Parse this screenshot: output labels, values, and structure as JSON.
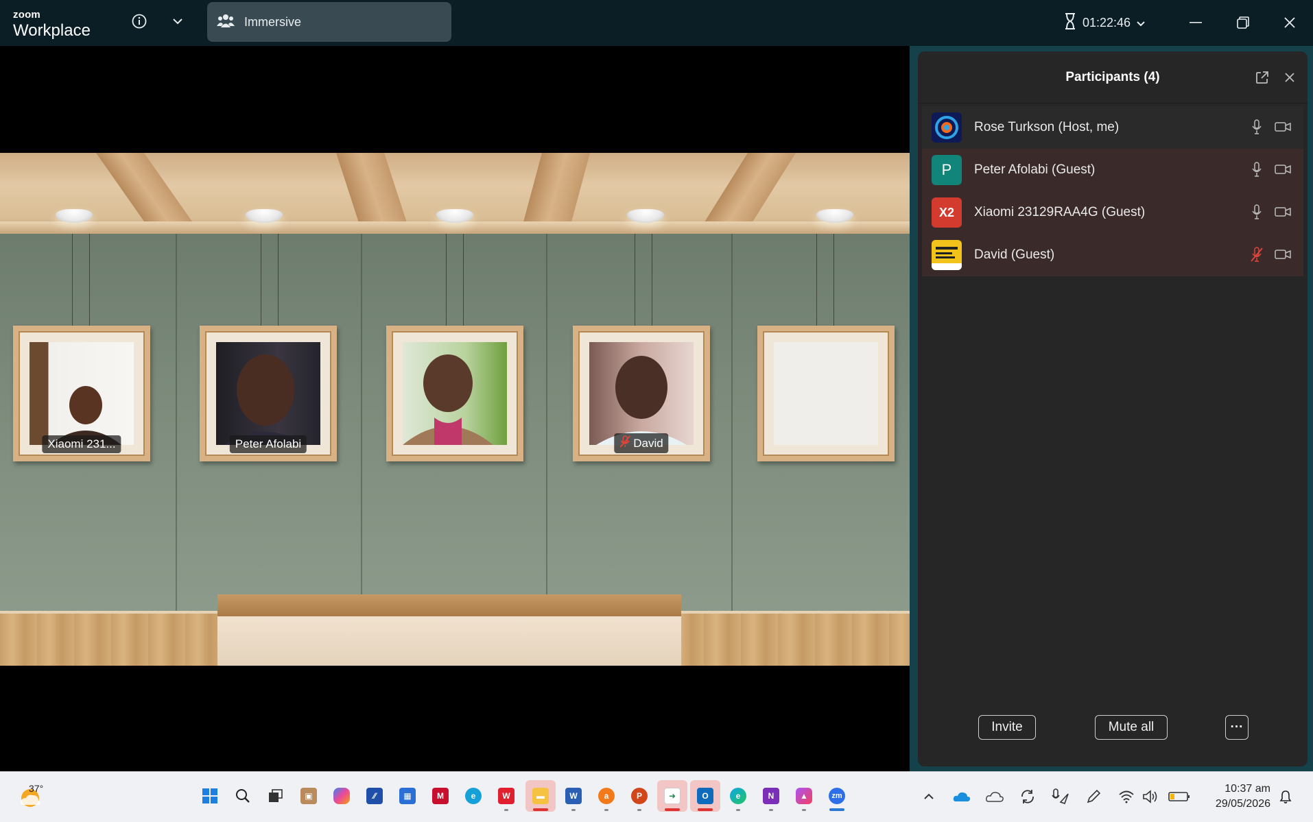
{
  "app": {
    "brand_small": "zoom",
    "brand_large": "Workplace"
  },
  "toolbar": {
    "view_label": "Immersive",
    "timer": "01:22:46"
  },
  "participants_panel": {
    "title": "Participants (4)",
    "participants": [
      {
        "name": "Rose Turkson (Host, me)",
        "avatar_text": "",
        "avatar_color": "#1a2b6e",
        "muted": false
      },
      {
        "name": "Peter Afolabi (Guest)",
        "avatar_text": "P",
        "avatar_color": "#12857a",
        "muted": false
      },
      {
        "name": "Xiaomi 23129RAA4G (Guest)",
        "avatar_text": "X2",
        "avatar_color": "#d23b2e",
        "muted": false
      },
      {
        "name": "David (Guest)",
        "avatar_text": "",
        "avatar_color": "#f2c31a",
        "muted": true
      }
    ],
    "invite_label": "Invite",
    "mute_all_label": "Mute all",
    "more_label": "···"
  },
  "stage": {
    "tiles": [
      {
        "label": "Xiaomi 231...",
        "muted": false
      },
      {
        "label": "Peter Afolabi",
        "muted": false
      },
      {
        "label": "",
        "muted": false
      },
      {
        "label": "David",
        "muted": true
      },
      {
        "label": "",
        "muted": false
      }
    ]
  },
  "taskbar": {
    "weather_temp": "37°",
    "clock_time": "10:37 am",
    "clock_date": "29/05/2026"
  },
  "colors": {
    "titlebar": "#0c1e25",
    "panel_accent": "#14414a",
    "mute_red": "#e0443a"
  }
}
